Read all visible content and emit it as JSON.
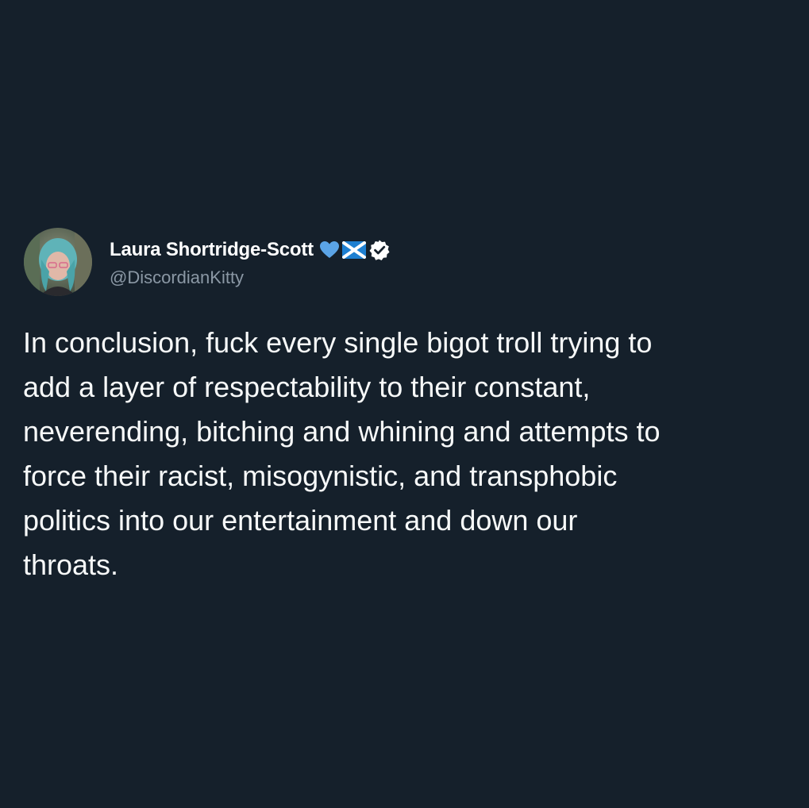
{
  "tweet": {
    "author": {
      "display_name": "Laura Shortridge-Scott",
      "handle": "@DiscordianKitty",
      "avatar_icon": "avatar-photo",
      "badges": [
        "blue-heart-icon",
        "scottish-flag-icon",
        "verified-badge-icon"
      ]
    },
    "text": "In conclusion, fuck every single bigot troll trying to\nadd a layer of respectability to their constant,\nneverending, bitching and whining and attempts to\nforce their racist, misogynistic, and transphobic\npolitics into our entertainment and down our\nthroats."
  },
  "colors": {
    "background": "#15202b",
    "text_primary": "#f7f9f9",
    "text_secondary": "#8b98a5",
    "heart_blue": "#5ba4e6",
    "flag_blue": "#1d9bf0"
  }
}
